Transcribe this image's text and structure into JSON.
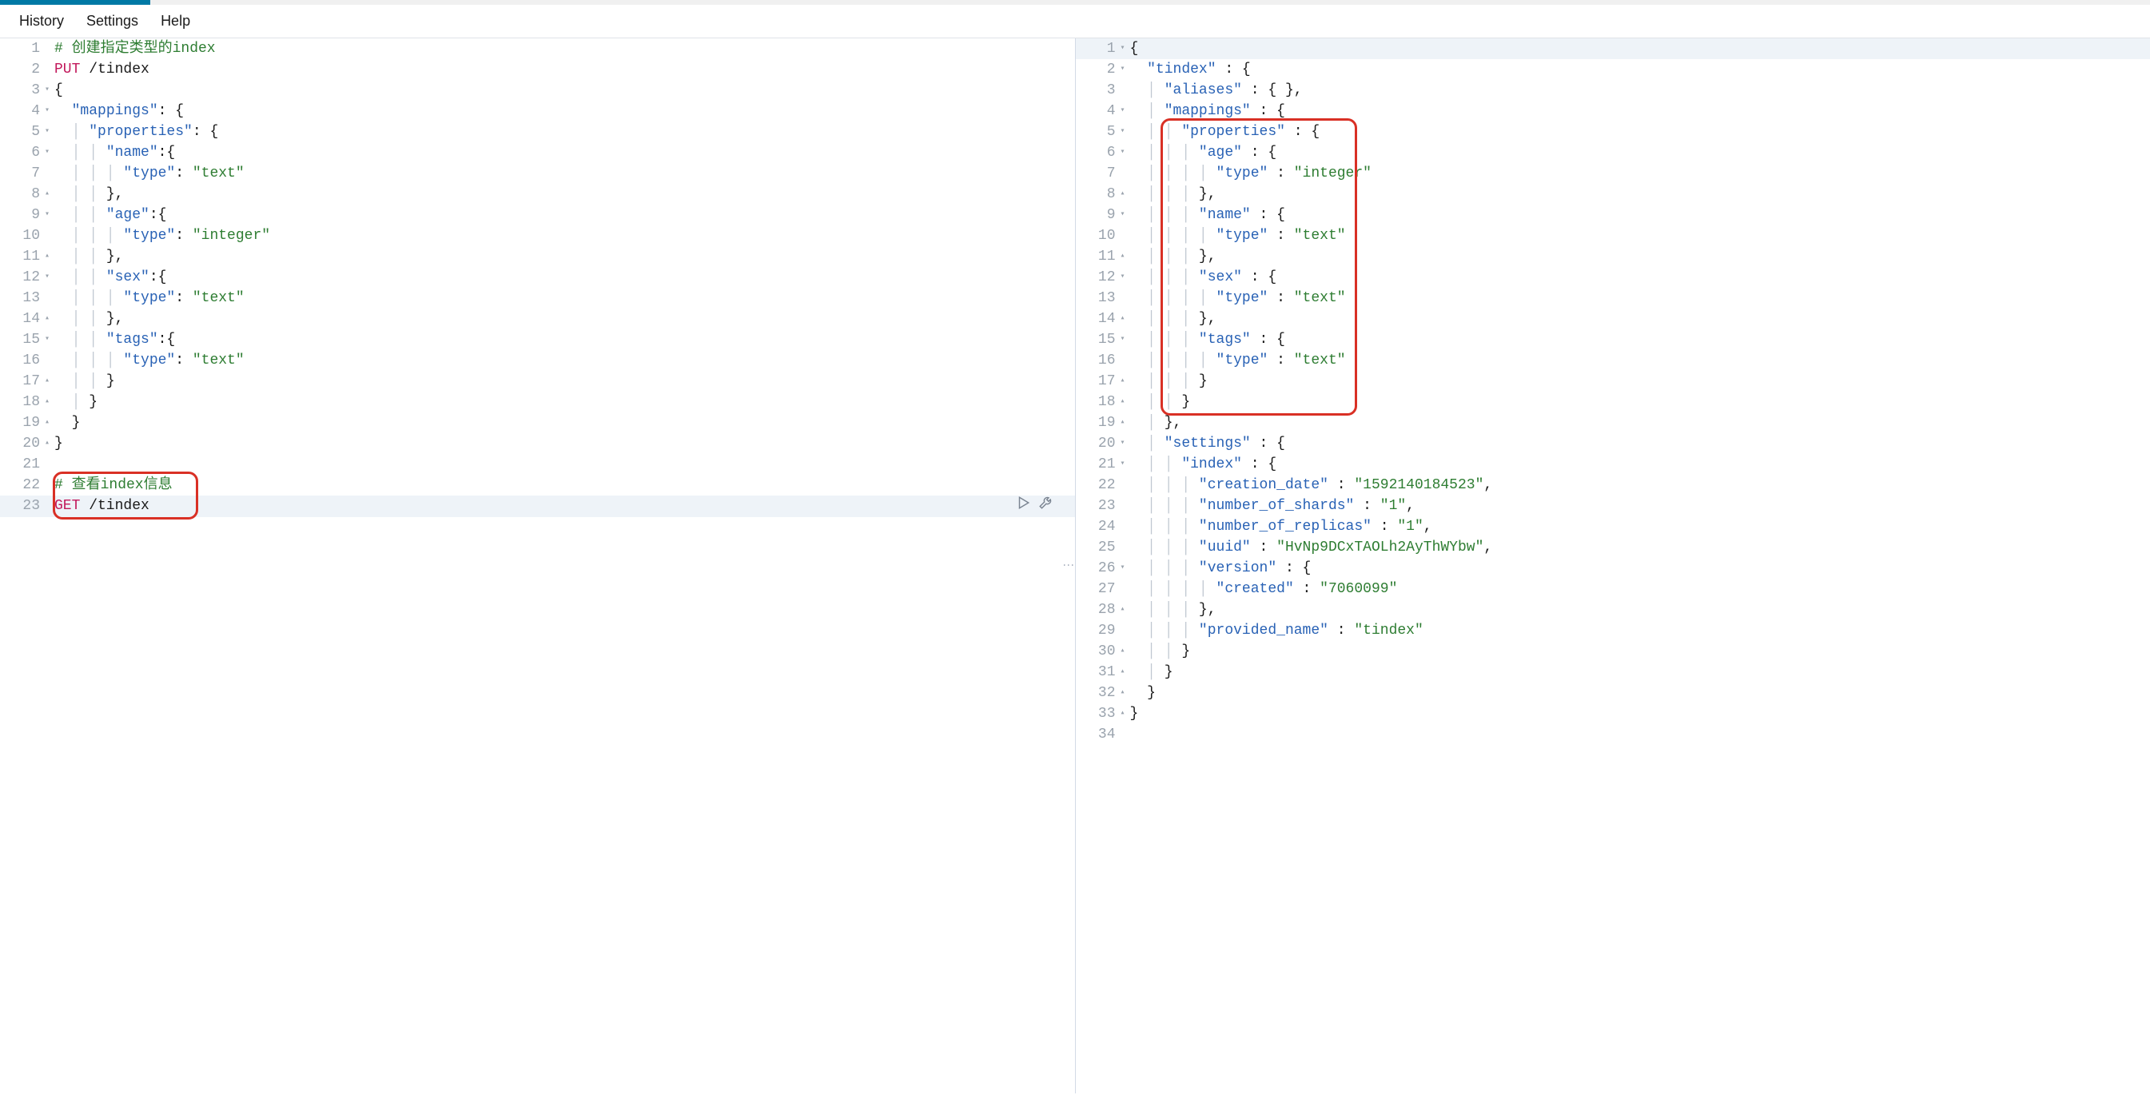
{
  "menu": {
    "history": "History",
    "settings": "Settings",
    "help": "Help"
  },
  "leftLines": [
    {
      "n": 1,
      "fold": "",
      "tokens": [
        [
          "comment",
          "# 创建指定类型的index"
        ]
      ]
    },
    {
      "n": 2,
      "fold": "",
      "tokens": [
        [
          "method",
          "PUT"
        ],
        [
          "punc",
          " /tindex"
        ]
      ]
    },
    {
      "n": 3,
      "fold": "▾",
      "tokens": [
        [
          "punc",
          "{"
        ]
      ]
    },
    {
      "n": 4,
      "fold": "▾",
      "tokens": [
        [
          "punc",
          "  "
        ],
        [
          "key",
          "\"mappings\""
        ],
        [
          "punc",
          ": {"
        ]
      ]
    },
    {
      "n": 5,
      "fold": "▾",
      "tokens": [
        [
          "guide",
          "  │ "
        ],
        [
          "key",
          "\"properties\""
        ],
        [
          "punc",
          ": {"
        ]
      ]
    },
    {
      "n": 6,
      "fold": "▾",
      "tokens": [
        [
          "guide",
          "  │ │ "
        ],
        [
          "key",
          "\"name\""
        ],
        [
          "punc",
          ":{"
        ]
      ]
    },
    {
      "n": 7,
      "fold": "",
      "tokens": [
        [
          "guide",
          "  │ │ │ "
        ],
        [
          "key",
          "\"type\""
        ],
        [
          "punc",
          ": "
        ],
        [
          "string",
          "\"text\""
        ]
      ]
    },
    {
      "n": 8,
      "fold": "▴",
      "tokens": [
        [
          "guide",
          "  │ │ "
        ],
        [
          "punc",
          "},"
        ]
      ]
    },
    {
      "n": 9,
      "fold": "▾",
      "tokens": [
        [
          "guide",
          "  │ │ "
        ],
        [
          "key",
          "\"age\""
        ],
        [
          "punc",
          ":{"
        ]
      ]
    },
    {
      "n": 10,
      "fold": "",
      "tokens": [
        [
          "guide",
          "  │ │ │ "
        ],
        [
          "key",
          "\"type\""
        ],
        [
          "punc",
          ": "
        ],
        [
          "string",
          "\"integer\""
        ]
      ]
    },
    {
      "n": 11,
      "fold": "▴",
      "tokens": [
        [
          "guide",
          "  │ │ "
        ],
        [
          "punc",
          "},"
        ]
      ]
    },
    {
      "n": 12,
      "fold": "▾",
      "tokens": [
        [
          "guide",
          "  │ │ "
        ],
        [
          "key",
          "\"sex\""
        ],
        [
          "punc",
          ":{"
        ]
      ]
    },
    {
      "n": 13,
      "fold": "",
      "tokens": [
        [
          "guide",
          "  │ │ │ "
        ],
        [
          "key",
          "\"type\""
        ],
        [
          "punc",
          ": "
        ],
        [
          "string",
          "\"text\""
        ]
      ]
    },
    {
      "n": 14,
      "fold": "▴",
      "tokens": [
        [
          "guide",
          "  │ │ "
        ],
        [
          "punc",
          "},"
        ]
      ]
    },
    {
      "n": 15,
      "fold": "▾",
      "tokens": [
        [
          "guide",
          "  │ │ "
        ],
        [
          "key",
          "\"tags\""
        ],
        [
          "punc",
          ":{"
        ]
      ]
    },
    {
      "n": 16,
      "fold": "",
      "tokens": [
        [
          "guide",
          "  │ │ │ "
        ],
        [
          "key",
          "\"type\""
        ],
        [
          "punc",
          ": "
        ],
        [
          "string",
          "\"text\""
        ]
      ]
    },
    {
      "n": 17,
      "fold": "▴",
      "tokens": [
        [
          "guide",
          "  │ │ "
        ],
        [
          "punc",
          "}"
        ]
      ]
    },
    {
      "n": 18,
      "fold": "▴",
      "tokens": [
        [
          "guide",
          "  │ "
        ],
        [
          "punc",
          "}"
        ]
      ]
    },
    {
      "n": 19,
      "fold": "▴",
      "tokens": [
        [
          "punc",
          "  }"
        ]
      ]
    },
    {
      "n": 20,
      "fold": "▴",
      "tokens": [
        [
          "punc",
          "}"
        ]
      ]
    },
    {
      "n": 21,
      "fold": "",
      "tokens": [
        [
          "punc",
          ""
        ]
      ]
    },
    {
      "n": 22,
      "fold": "",
      "tokens": [
        [
          "comment",
          "# 查看index信息"
        ]
      ]
    },
    {
      "n": 23,
      "fold": "",
      "active": true,
      "runIcons": true,
      "tokens": [
        [
          "method",
          "GET"
        ],
        [
          "punc",
          " /tindex"
        ]
      ]
    }
  ],
  "rightLines": [
    {
      "n": 1,
      "fold": "▾",
      "active": true,
      "tokens": [
        [
          "punc",
          "{"
        ]
      ]
    },
    {
      "n": 2,
      "fold": "▾",
      "tokens": [
        [
          "punc",
          "  "
        ],
        [
          "key",
          "\"tindex\""
        ],
        [
          "punc",
          " : {"
        ]
      ]
    },
    {
      "n": 3,
      "fold": "",
      "tokens": [
        [
          "guide",
          "  │ "
        ],
        [
          "key",
          "\"aliases\""
        ],
        [
          "punc",
          " : { },"
        ]
      ]
    },
    {
      "n": 4,
      "fold": "▾",
      "tokens": [
        [
          "guide",
          "  │ "
        ],
        [
          "key",
          "\"mappings\""
        ],
        [
          "punc",
          " : {"
        ]
      ]
    },
    {
      "n": 5,
      "fold": "▾",
      "tokens": [
        [
          "guide",
          "  │ │ "
        ],
        [
          "key",
          "\"properties\""
        ],
        [
          "punc",
          " : {"
        ]
      ]
    },
    {
      "n": 6,
      "fold": "▾",
      "tokens": [
        [
          "guide",
          "  │ │ │ "
        ],
        [
          "key",
          "\"age\""
        ],
        [
          "punc",
          " : {"
        ]
      ]
    },
    {
      "n": 7,
      "fold": "",
      "tokens": [
        [
          "guide",
          "  │ │ │ │ "
        ],
        [
          "key",
          "\"type\""
        ],
        [
          "punc",
          " : "
        ],
        [
          "string",
          "\"integer\""
        ]
      ]
    },
    {
      "n": 8,
      "fold": "▴",
      "tokens": [
        [
          "guide",
          "  │ │ │ "
        ],
        [
          "punc",
          "},"
        ]
      ]
    },
    {
      "n": 9,
      "fold": "▾",
      "tokens": [
        [
          "guide",
          "  │ │ │ "
        ],
        [
          "key",
          "\"name\""
        ],
        [
          "punc",
          " : {"
        ]
      ]
    },
    {
      "n": 10,
      "fold": "",
      "tokens": [
        [
          "guide",
          "  │ │ │ │ "
        ],
        [
          "key",
          "\"type\""
        ],
        [
          "punc",
          " : "
        ],
        [
          "string",
          "\"text\""
        ]
      ]
    },
    {
      "n": 11,
      "fold": "▴",
      "tokens": [
        [
          "guide",
          "  │ │ │ "
        ],
        [
          "punc",
          "},"
        ]
      ]
    },
    {
      "n": 12,
      "fold": "▾",
      "tokens": [
        [
          "guide",
          "  │ │ │ "
        ],
        [
          "key",
          "\"sex\""
        ],
        [
          "punc",
          " : {"
        ]
      ]
    },
    {
      "n": 13,
      "fold": "",
      "tokens": [
        [
          "guide",
          "  │ │ │ │ "
        ],
        [
          "key",
          "\"type\""
        ],
        [
          "punc",
          " : "
        ],
        [
          "string",
          "\"text\""
        ]
      ]
    },
    {
      "n": 14,
      "fold": "▴",
      "tokens": [
        [
          "guide",
          "  │ │ │ "
        ],
        [
          "punc",
          "},"
        ]
      ]
    },
    {
      "n": 15,
      "fold": "▾",
      "tokens": [
        [
          "guide",
          "  │ │ │ "
        ],
        [
          "key",
          "\"tags\""
        ],
        [
          "punc",
          " : {"
        ]
      ]
    },
    {
      "n": 16,
      "fold": "",
      "tokens": [
        [
          "guide",
          "  │ │ │ │ "
        ],
        [
          "key",
          "\"type\""
        ],
        [
          "punc",
          " : "
        ],
        [
          "string",
          "\"text\""
        ]
      ]
    },
    {
      "n": 17,
      "fold": "▴",
      "tokens": [
        [
          "guide",
          "  │ │ │ "
        ],
        [
          "punc",
          "}"
        ]
      ]
    },
    {
      "n": 18,
      "fold": "▴",
      "tokens": [
        [
          "guide",
          "  │ │ "
        ],
        [
          "punc",
          "}"
        ]
      ]
    },
    {
      "n": 19,
      "fold": "▴",
      "tokens": [
        [
          "guide",
          "  │ "
        ],
        [
          "punc",
          "},"
        ]
      ]
    },
    {
      "n": 20,
      "fold": "▾",
      "tokens": [
        [
          "guide",
          "  │ "
        ],
        [
          "key",
          "\"settings\""
        ],
        [
          "punc",
          " : {"
        ]
      ]
    },
    {
      "n": 21,
      "fold": "▾",
      "tokens": [
        [
          "guide",
          "  │ │ "
        ],
        [
          "key",
          "\"index\""
        ],
        [
          "punc",
          " : {"
        ]
      ]
    },
    {
      "n": 22,
      "fold": "",
      "tokens": [
        [
          "guide",
          "  │ │ │ "
        ],
        [
          "key",
          "\"creation_date\""
        ],
        [
          "punc",
          " : "
        ],
        [
          "string",
          "\"1592140184523\""
        ],
        [
          "punc",
          ","
        ]
      ]
    },
    {
      "n": 23,
      "fold": "",
      "tokens": [
        [
          "guide",
          "  │ │ │ "
        ],
        [
          "key",
          "\"number_of_shards\""
        ],
        [
          "punc",
          " : "
        ],
        [
          "string",
          "\"1\""
        ],
        [
          "punc",
          ","
        ]
      ]
    },
    {
      "n": 24,
      "fold": "",
      "tokens": [
        [
          "guide",
          "  │ │ │ "
        ],
        [
          "key",
          "\"number_of_replicas\""
        ],
        [
          "punc",
          " : "
        ],
        [
          "string",
          "\"1\""
        ],
        [
          "punc",
          ","
        ]
      ]
    },
    {
      "n": 25,
      "fold": "",
      "tokens": [
        [
          "guide",
          "  │ │ │ "
        ],
        [
          "key",
          "\"uuid\""
        ],
        [
          "punc",
          " : "
        ],
        [
          "string",
          "\"HvNp9DCxTAOLh2AyThWYbw\""
        ],
        [
          "punc",
          ","
        ]
      ]
    },
    {
      "n": 26,
      "fold": "▾",
      "tokens": [
        [
          "guide",
          "  │ │ │ "
        ],
        [
          "key",
          "\"version\""
        ],
        [
          "punc",
          " : {"
        ]
      ]
    },
    {
      "n": 27,
      "fold": "",
      "tokens": [
        [
          "guide",
          "  │ │ │ │ "
        ],
        [
          "key",
          "\"created\""
        ],
        [
          "punc",
          " : "
        ],
        [
          "string",
          "\"7060099\""
        ]
      ]
    },
    {
      "n": 28,
      "fold": "▴",
      "tokens": [
        [
          "guide",
          "  │ │ │ "
        ],
        [
          "punc",
          "},"
        ]
      ]
    },
    {
      "n": 29,
      "fold": "",
      "tokens": [
        [
          "guide",
          "  │ │ │ "
        ],
        [
          "key",
          "\"provided_name\""
        ],
        [
          "punc",
          " : "
        ],
        [
          "string",
          "\"tindex\""
        ]
      ]
    },
    {
      "n": 30,
      "fold": "▴",
      "tokens": [
        [
          "guide",
          "  │ │ "
        ],
        [
          "punc",
          "}"
        ]
      ]
    },
    {
      "n": 31,
      "fold": "▴",
      "tokens": [
        [
          "guide",
          "  │ "
        ],
        [
          "punc",
          "}"
        ]
      ]
    },
    {
      "n": 32,
      "fold": "▴",
      "tokens": [
        [
          "punc",
          "  }"
        ]
      ]
    },
    {
      "n": 33,
      "fold": "▴",
      "tokens": [
        [
          "punc",
          "}"
        ]
      ]
    },
    {
      "n": 34,
      "fold": "",
      "tokens": [
        [
          "punc",
          ""
        ]
      ]
    }
  ],
  "annotations": {
    "left": {
      "topLine": 22,
      "bottomLine": 23,
      "leftPx": 66,
      "rightPx": 248
    },
    "right": {
      "topLine": 5,
      "bottomLine": 18,
      "leftPx": 106,
      "rightPx": 352
    }
  }
}
